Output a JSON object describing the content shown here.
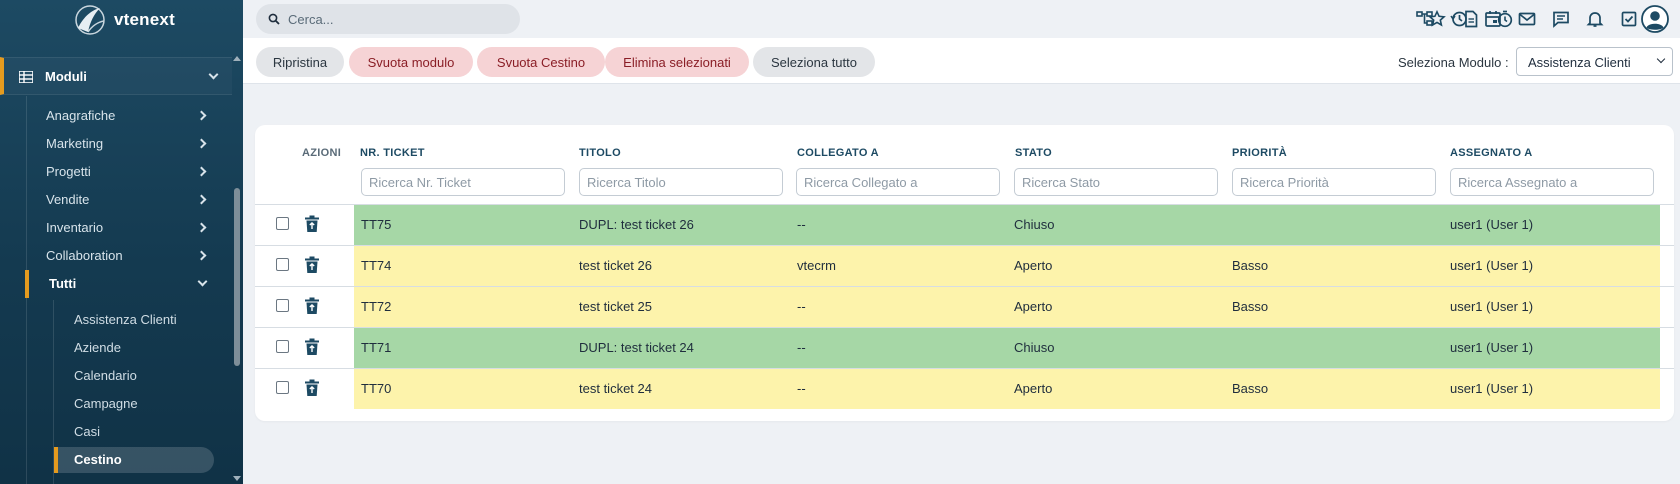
{
  "app": {
    "logo_text": "vtenext"
  },
  "topbar": {
    "search_placeholder": "Cerca...",
    "icons": [
      "hierarchy-icon",
      "history-icon",
      "calendar-icon",
      "mail-icon",
      "chat-icon",
      "bell-icon",
      "checklist-icon",
      "bolt-icon",
      "star-icon",
      "document-icon",
      "timer-icon",
      "user-avatar-icon"
    ]
  },
  "sidebar": {
    "section_label": "Moduli",
    "items": [
      {
        "label": "Anagrafiche"
      },
      {
        "label": "Marketing"
      },
      {
        "label": "Progetti"
      },
      {
        "label": "Vendite"
      },
      {
        "label": "Inventario"
      },
      {
        "label": "Collaboration"
      },
      {
        "label": "Tutti"
      }
    ],
    "subitems": [
      {
        "label": "Assistenza Clienti"
      },
      {
        "label": "Aziende"
      },
      {
        "label": "Calendario"
      },
      {
        "label": "Campagne"
      },
      {
        "label": "Casi"
      },
      {
        "label": "Cestino"
      }
    ]
  },
  "toolbar": {
    "restore_label": "Ripristina",
    "empty_module_label": "Svuota modulo",
    "empty_trash_label": "Svuota Cestino",
    "delete_selected_label": "Elimina selezionati",
    "select_all_label": "Seleziona tutto",
    "module_select_label": "Seleziona Modulo :",
    "module_select_value": "Assistenza Clienti"
  },
  "table": {
    "actions_header": "AZIONI",
    "columns": [
      {
        "header": "NR. TICKET",
        "placeholder": "Ricerca Nr. Ticket"
      },
      {
        "header": "TITOLO",
        "placeholder": "Ricerca Titolo"
      },
      {
        "header": "COLLEGATO A",
        "placeholder": "Ricerca Collegato a"
      },
      {
        "header": "STATO",
        "placeholder": "Ricerca Stato"
      },
      {
        "header": "PRIORITÀ",
        "placeholder": "Ricerca Priorità"
      },
      {
        "header": "ASSEGNATO A",
        "placeholder": "Ricerca Assegnato a"
      }
    ],
    "rows": [
      {
        "color": "green",
        "cells": [
          "TT75",
          "DUPL: test ticket 26",
          "--",
          "Chiuso",
          "",
          "user1 (User 1)"
        ]
      },
      {
        "color": "yellow",
        "cells": [
          "TT74",
          "test ticket 26",
          "vtecrm",
          "Aperto",
          "Basso",
          "user1 (User 1)"
        ]
      },
      {
        "color": "yellow",
        "cells": [
          "TT72",
          "test ticket 25",
          "--",
          "Aperto",
          "Basso",
          "user1 (User 1)"
        ]
      },
      {
        "color": "green",
        "cells": [
          "TT71",
          "DUPL: test ticket 24",
          "--",
          "Chiuso",
          "",
          "user1 (User 1)"
        ]
      },
      {
        "color": "yellow",
        "cells": [
          "TT70",
          "test ticket 24",
          "--",
          "Aperto",
          "Basso",
          "user1 (User 1)"
        ]
      }
    ]
  },
  "colors": {
    "sidebar_bg": "#1d4a63",
    "accent": "#e59b1f",
    "closed_row": "#a6d7a6",
    "open_row": "#fdf3ab",
    "danger_button": "#f6d3d5"
  }
}
